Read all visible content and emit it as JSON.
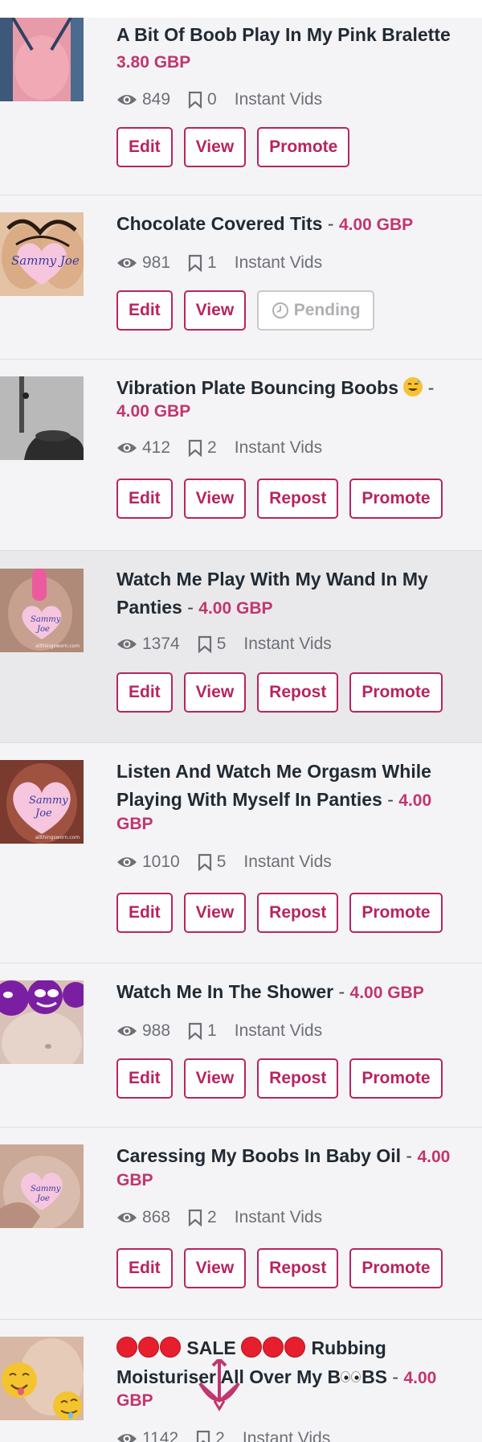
{
  "colors": {
    "accent": "#b8245f",
    "price": "#c2356f",
    "highlight_row": "#e9e9eb",
    "pending": "#b0b0b4"
  },
  "items": [
    {
      "title": "A Bit Of Boob Play In My Pink Bralette",
      "separator": "",
      "price": "3.80 GBP",
      "views": "849",
      "saves": "0",
      "category": "Instant Vids",
      "buttons": [
        "Edit",
        "View",
        "Promote"
      ]
    },
    {
      "title": "Chocolate Covered Tits",
      "separator": "-",
      "price": "4.00 GBP",
      "views": "981",
      "saves": "1",
      "category": "Instant Vids",
      "buttons": [
        "Edit",
        "View"
      ],
      "pending_label": "Pending",
      "thumb_watermark": "Sammy Joe"
    },
    {
      "title": "Vibration Plate Bouncing Boobs",
      "separator": "-",
      "price": "4.00 GBP",
      "views": "412",
      "saves": "2",
      "category": "Instant Vids",
      "buttons": [
        "Edit",
        "View",
        "Repost",
        "Promote"
      ]
    },
    {
      "title_line1": "Watch Me Play With My Wand In My",
      "title_line2": "Panties",
      "separator": "-",
      "price": "4.00 GBP",
      "views": "1374",
      "saves": "5",
      "category": "Instant Vids",
      "buttons": [
        "Edit",
        "View",
        "Repost",
        "Promote"
      ],
      "thumb_watermark": "allthingsworn.com"
    },
    {
      "title_line1": "Listen And Watch Me Orgasm While",
      "title_line2": "Playing With Myself In Panties",
      "separator": "-",
      "price_part1": "4.00",
      "price_part2": "GBP",
      "views": "1010",
      "saves": "5",
      "category": "Instant Vids",
      "buttons": [
        "Edit",
        "View",
        "Repost",
        "Promote"
      ],
      "thumb_watermark": "allthingsworn.com"
    },
    {
      "title": "Watch Me In The Shower",
      "separator": "-",
      "price": "4.00 GBP",
      "views": "988",
      "saves": "1",
      "category": "Instant Vids",
      "buttons": [
        "Edit",
        "View",
        "Repost",
        "Promote"
      ]
    },
    {
      "title": "Caressing My Boobs In Baby Oil",
      "separator": "-",
      "price_part1": "4.00",
      "price_part2": "GBP",
      "views": "868",
      "saves": "2",
      "category": "Instant Vids",
      "buttons": [
        "Edit",
        "View",
        "Repost",
        "Promote"
      ]
    },
    {
      "title_word_sale": "SALE",
      "title_word_rubbing": "Rubbing",
      "title_line2_a": "Moisturiser All Over My B",
      "title_line2_b": "BS",
      "separator": "-",
      "price_part1": "4.00",
      "price_part2": "GBP",
      "views": "1142",
      "saves": "2",
      "category": "Instant Vids"
    }
  ]
}
